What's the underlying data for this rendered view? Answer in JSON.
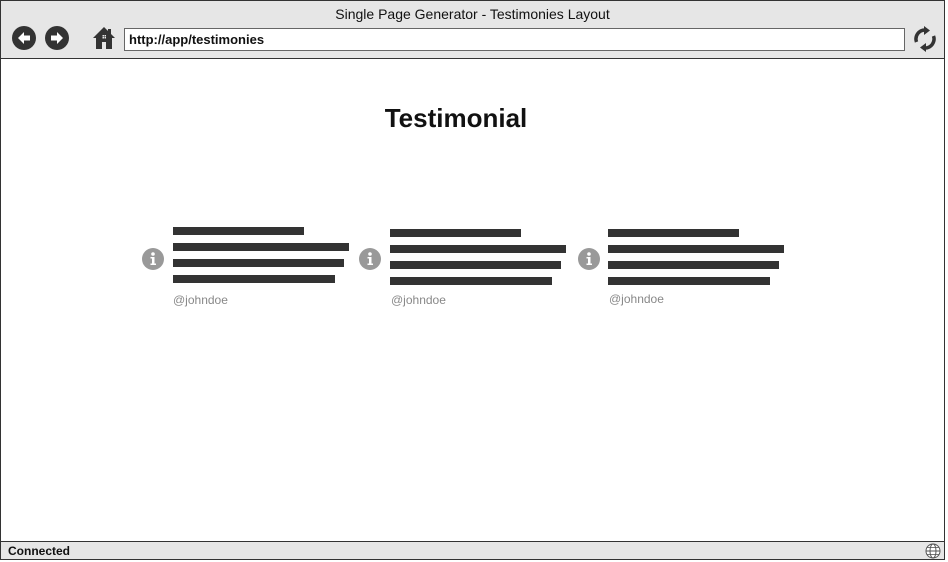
{
  "window": {
    "title": "Single Page Generator - Testimonies Layout"
  },
  "toolbar": {
    "back_icon": "arrow-left-icon",
    "forward_icon": "arrow-right-icon",
    "home_icon": "home-icon",
    "refresh_icon": "refresh-icon",
    "url": "http://app/testimonies"
  },
  "page": {
    "heading": "Testimonial"
  },
  "testimonials": [
    {
      "handle": "@johndoe",
      "icon": "info-icon"
    },
    {
      "handle": "@johndoe",
      "icon": "info-icon"
    },
    {
      "handle": "@johndoe",
      "icon": "info-icon"
    }
  ],
  "status": {
    "text": "Connected",
    "icon": "globe-icon"
  },
  "colors": {
    "chrome": "#e6e6e6",
    "border": "#333333",
    "text_placeholder": "#333333",
    "icon_gray": "#999999",
    "handle_gray": "#888888"
  }
}
